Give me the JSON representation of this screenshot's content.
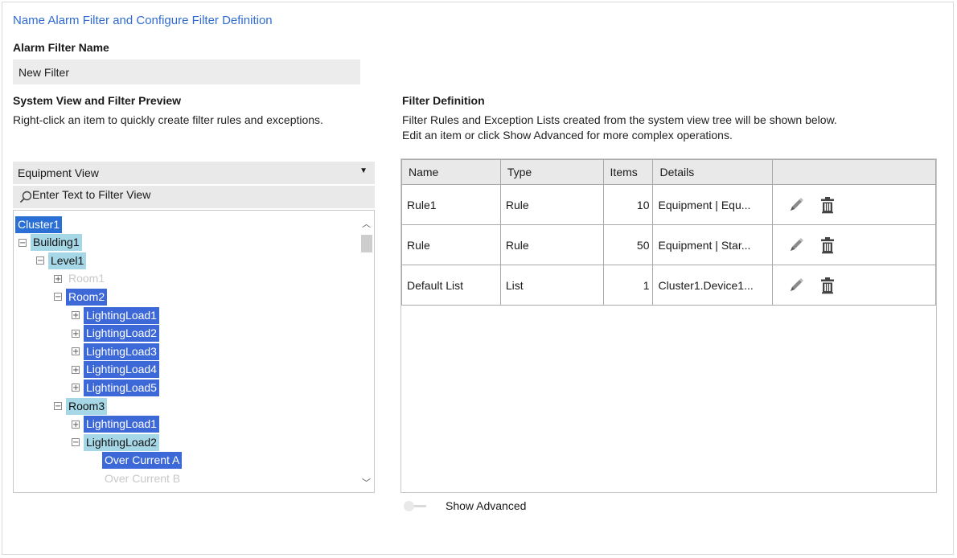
{
  "page_title": "Name Alarm Filter and Configure Filter Definition",
  "filter_name": {
    "label": "Alarm Filter Name",
    "value": "New Filter"
  },
  "system_view": {
    "heading": "System View and Filter Preview",
    "description": "Right-click an item to quickly create filter rules and exceptions.",
    "view_select": "Equipment View",
    "filter_placeholder": "Enter Text to Filter View",
    "tree": [
      {
        "label": "Cluster1",
        "toggle": "",
        "style": "dark"
      },
      {
        "label": "Building1",
        "toggle": "⊟",
        "style": "light"
      },
      {
        "label": "Level1",
        "toggle": "⊟",
        "style": "light"
      },
      {
        "label": "Room1",
        "toggle": "⊞",
        "style": "dim"
      },
      {
        "label": "Room2",
        "toggle": "⊟",
        "style": "mid"
      },
      {
        "label": "LightingLoad1",
        "toggle": "⊞",
        "style": "mid"
      },
      {
        "label": "LightingLoad2",
        "toggle": "⊞",
        "style": "mid"
      },
      {
        "label": "LightingLoad3",
        "toggle": "⊞",
        "style": "mid"
      },
      {
        "label": "LightingLoad4",
        "toggle": "⊞",
        "style": "mid"
      },
      {
        "label": "LightingLoad5",
        "toggle": "⊞",
        "style": "mid"
      },
      {
        "label": "Room3",
        "toggle": "⊟",
        "style": "light"
      },
      {
        "label": "LightingLoad1",
        "toggle": "⊞",
        "style": "mid"
      },
      {
        "label": "LightingLoad2",
        "toggle": "⊟",
        "style": "light"
      },
      {
        "label": "Over Current A",
        "toggle": "",
        "style": "mid"
      },
      {
        "label": "Over Current B",
        "toggle": "",
        "style": "dim"
      }
    ]
  },
  "filter_definition": {
    "heading": "Filter Definition",
    "description_line1": "Filter Rules and Exception Lists created from the system view tree will be shown below.",
    "description_line2": "Edit an item or click Show Advanced for more complex operations.",
    "columns": [
      "Name",
      "Type",
      "Items",
      "Details",
      ""
    ],
    "rows": [
      {
        "name": "Rule1",
        "type": "Rule",
        "items": "10",
        "details": "Equipment | Equ..."
      },
      {
        "name": "Rule",
        "type": "Rule",
        "items": "50",
        "details": "Equipment | Star..."
      },
      {
        "name": "Default List",
        "type": "List",
        "items": "1",
        "details": "Cluster1.Device1..."
      }
    ],
    "row_icons": [
      "pencil-icon",
      "trash-icon"
    ]
  },
  "show_advanced": {
    "label": "Show Advanced",
    "enabled": false
  },
  "colors": {
    "title": "#2f6bd0",
    "selection_dark": "#2a6fd6",
    "selection_mid": "#3d68d8",
    "selection_light": "#a6d7e6"
  }
}
